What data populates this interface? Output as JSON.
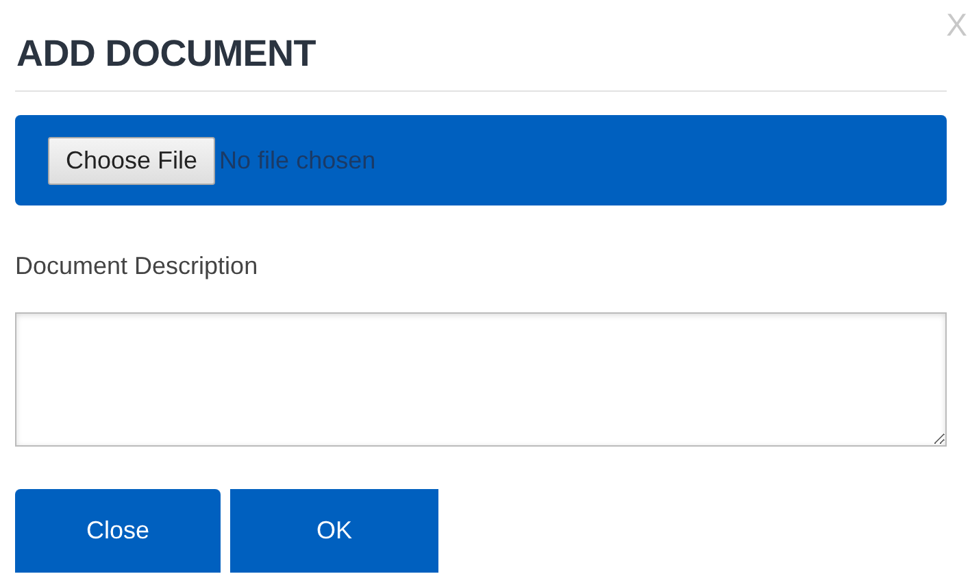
{
  "dialog": {
    "title": "ADD DOCUMENT",
    "close_icon": "X"
  },
  "file_input": {
    "button": "Choose File",
    "status": "No file chosen"
  },
  "description": {
    "label": "Document Description"
  },
  "buttons": [
    "Close",
    "OK"
  ]
}
